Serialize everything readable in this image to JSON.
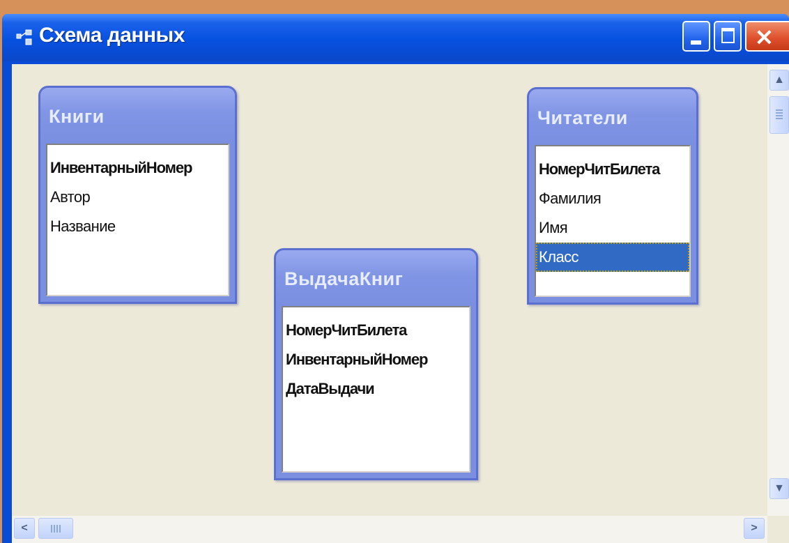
{
  "window": {
    "title": "Схема данных",
    "close_glyph": "✕"
  },
  "icons": {
    "app": "relationships-icon",
    "minimize": "minimize-icon",
    "maximize": "maximize-icon",
    "close": "close-icon",
    "scroll_up": "▲",
    "scroll_down": "▼",
    "scroll_left": "<",
    "scroll_right": ">"
  },
  "tables": {
    "knigi": {
      "title": "Книги",
      "fields": [
        "ИнвентарныйНомер",
        "Автор",
        "Название"
      ],
      "key_fields": [
        "ИнвентарныйНомер"
      ]
    },
    "vydacha": {
      "title": "ВыдачаКниг",
      "fields": [
        "НомерЧитБилета",
        "ИнвентарныйНомер",
        "ДатаВыдачи"
      ],
      "key_fields": [
        "НомерЧитБилета",
        "ИнвентарныйНомер",
        "ДатаВыдачи"
      ]
    },
    "chitateli": {
      "title": "Читатели",
      "fields": [
        "НомерЧитБилета",
        "Фамилия",
        "Имя",
        "Класс"
      ],
      "key_fields": [
        "НомерЧитБилета"
      ],
      "selected_field": "Класс"
    }
  },
  "colors": {
    "titlebar": "#0751e0",
    "table_header": "#7b8fe1",
    "selection": "#316ac5",
    "workspace": "#ece9d8"
  }
}
